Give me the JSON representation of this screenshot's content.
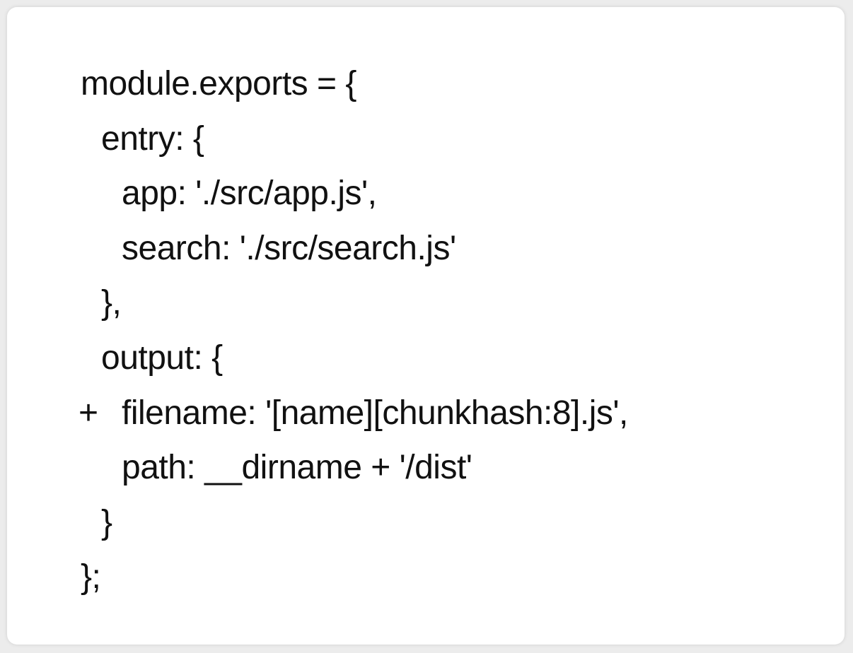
{
  "code": {
    "lines": [
      {
        "marker": "",
        "text": "module.exports = {"
      },
      {
        "marker": "",
        "text": "entry: {"
      },
      {
        "marker": "",
        "text": "app: './src/app.js',"
      },
      {
        "marker": "",
        "text": "search: './src/search.js'"
      },
      {
        "marker": "",
        "text": "},"
      },
      {
        "marker": "",
        "text": "output: {"
      },
      {
        "marker": "+",
        "text": "filename: '[name][chunkhash:8].js',"
      },
      {
        "marker": "",
        "text": "path: __dirname + '/dist'"
      },
      {
        "marker": "",
        "text": "}"
      },
      {
        "marker": "",
        "text": "};"
      }
    ]
  }
}
